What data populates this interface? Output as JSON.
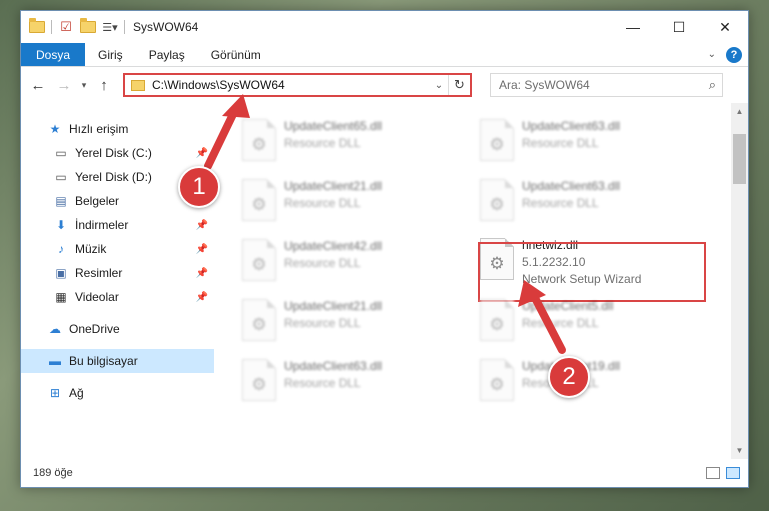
{
  "window": {
    "title": "SysWOW64",
    "controls": {
      "minimize": "—",
      "maximize": "☐",
      "close": "✕"
    }
  },
  "ribbon": {
    "tabs": [
      "Dosya",
      "Giriş",
      "Paylaş",
      "Görünüm"
    ],
    "expand_icon": "chevron-down-icon",
    "help": "?"
  },
  "nav": {
    "address": "C:\\Windows\\SysWOW64",
    "search_placeholder": "Ara: SysWOW64"
  },
  "sidebar": {
    "items": [
      {
        "label": "Hızlı erişim",
        "icon": "star-icon",
        "pinned": false
      },
      {
        "label": "Yerel Disk (C:)",
        "icon": "drive-icon",
        "pinned": true
      },
      {
        "label": "Yerel Disk (D:)",
        "icon": "drive-icon",
        "pinned": false
      },
      {
        "label": "Belgeler",
        "icon": "documents-icon",
        "pinned": true
      },
      {
        "label": "İndirmeler",
        "icon": "download-icon",
        "pinned": true
      },
      {
        "label": "Müzik",
        "icon": "music-icon",
        "pinned": true
      },
      {
        "label": "Resimler",
        "icon": "pictures-icon",
        "pinned": true
      },
      {
        "label": "Videolar",
        "icon": "video-icon",
        "pinned": true
      },
      {
        "label": "OneDrive",
        "icon": "cloud-icon",
        "pinned": false
      },
      {
        "label": "Bu bilgisayar",
        "icon": "computer-icon",
        "pinned": false
      },
      {
        "label": "Ağ",
        "icon": "network-icon",
        "pinned": false
      }
    ]
  },
  "files": [
    {
      "name": "UpdateClient65.dll",
      "sub1": "Resource DLL",
      "sub2": ""
    },
    {
      "name": "UpdateClient63.dll",
      "sub1": "Resource DLL",
      "sub2": ""
    },
    {
      "name": "UpdateClient21.dll",
      "sub1": "Resource DLL",
      "sub2": ""
    },
    {
      "name": "UpdateClient63.dll",
      "sub1": "Resource DLL",
      "sub2": ""
    },
    {
      "name": "UpdateClient42.dll",
      "sub1": "Resource DLL",
      "sub2": ""
    },
    {
      "name": "hnetwiz.dll",
      "sub1": "5.1.2232.10",
      "sub2": "Network Setup Wizard"
    },
    {
      "name": "UpdateClient21.dll",
      "sub1": "Resource DLL",
      "sub2": ""
    },
    {
      "name": "UpdateClient5.dll",
      "sub1": "Resource DLL",
      "sub2": ""
    },
    {
      "name": "UpdateClient63.dll",
      "sub1": "Resource DLL",
      "sub2": ""
    },
    {
      "name": "UpdateClient19.dll",
      "sub1": "Resource DLL",
      "sub2": ""
    }
  ],
  "status": {
    "count": "189 öğe"
  },
  "annotations": {
    "badge1": "1",
    "badge2": "2",
    "color": "#d93b3b"
  }
}
